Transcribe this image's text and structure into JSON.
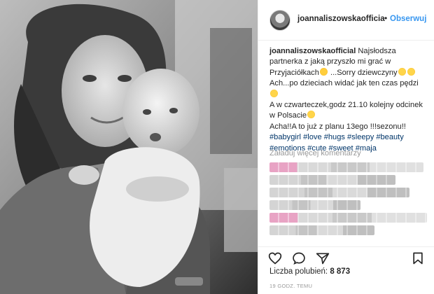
{
  "post": {
    "username": "joannaliszowskaofficia",
    "follow_label": "Obserwuj",
    "dot": "•"
  },
  "caption": {
    "username": "joannaliszowskaofficial",
    "line1": " Najsłodsza",
    "line2": "partnerka z jaką przyszło mi grać w",
    "line3a": "Przyjaciółkach",
    "line3b": " ...Sorry dziewczyny",
    "line4": "Ach...po dzieciach widać jak ten czas pędzi",
    "line6": "A w czwarteczek,godz 21.10 kolejny odcinek",
    "line7": "w Polsacie",
    "line8": "Acha!!A to już z planu 13ego !!!sezonu!!",
    "tags_line1": "#babygirl #love #hugs #sleepy #beauty",
    "tags_line2": "#emotions #cute #sweet #maja"
  },
  "comments": {
    "load_more": "Załaduj więcej komentarzy"
  },
  "footer": {
    "likes_label": "Liczba polubień: ",
    "likes_count": "8 873",
    "timestamp": "19 GODZ. TEMU"
  },
  "icons": {
    "like": "heart-icon",
    "comment": "comment-icon",
    "share": "share-icon",
    "save": "bookmark-icon",
    "more": "more-icon"
  },
  "colors": {
    "link_blue": "#3897f0",
    "hashtag": "#003569",
    "text": "#262626",
    "muted": "#999999"
  }
}
